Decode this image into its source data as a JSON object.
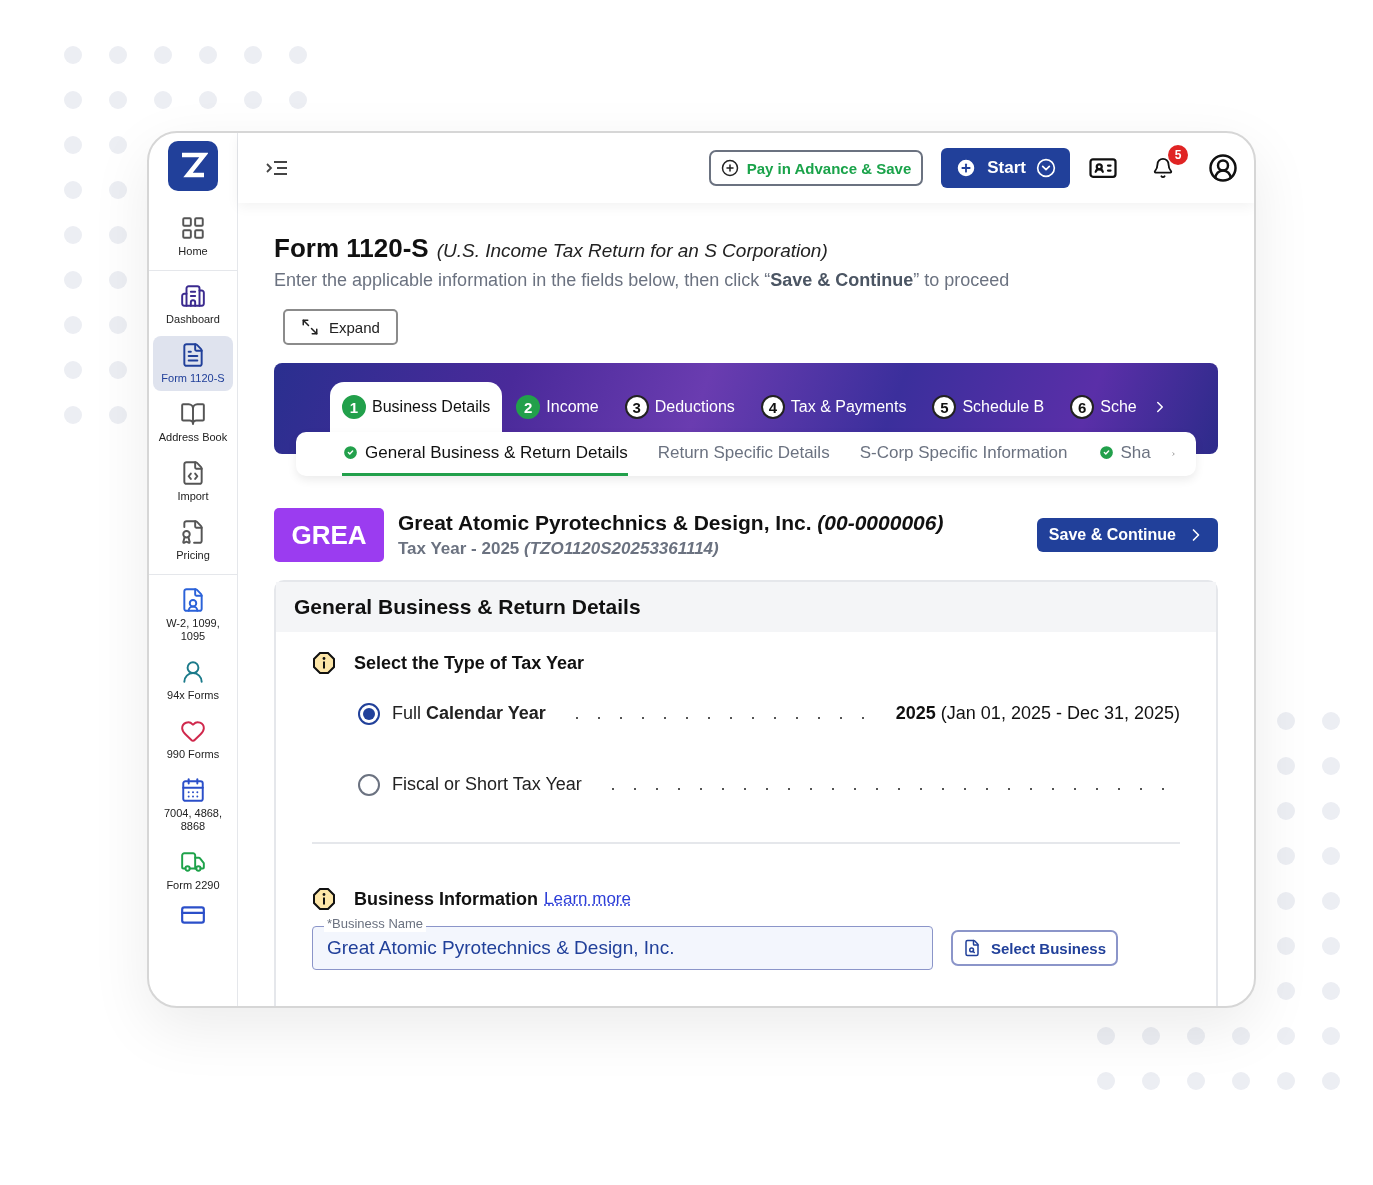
{
  "sidebar": {
    "groups": [
      {
        "items": [
          {
            "label": "Home",
            "selected": false
          }
        ]
      },
      {
        "items": [
          {
            "label": "Dashboard",
            "selected": false
          },
          {
            "label": "Form 1120-S",
            "selected": true
          },
          {
            "label": "Address Book",
            "selected": false
          },
          {
            "label": "Import",
            "selected": false
          },
          {
            "label": "Pricing",
            "selected": false
          }
        ]
      },
      {
        "items": [
          {
            "label": "W-2, 1099, 1095",
            "selected": false
          },
          {
            "label": "94x Forms",
            "selected": false
          },
          {
            "label": "990 Forms",
            "selected": false
          },
          {
            "label": "7004, 4868, 8868",
            "selected": false
          },
          {
            "label": "Form 2290",
            "selected": false
          }
        ]
      }
    ]
  },
  "topbar": {
    "pay_button": "Pay in Advance & Save",
    "start_button": "Start",
    "notifications": "5"
  },
  "header": {
    "title": "Form 1120-S",
    "subtitle": "(U.S. Income Tax Return for an S Corporation)",
    "instruction": "Enter the applicable information in the fields below, then click “**Save & Continue**” to proceed",
    "expand_button": "Expand"
  },
  "steps": [
    {
      "number": "1",
      "label": "Business Details",
      "selected": true,
      "done": true
    },
    {
      "number": "2",
      "label": "Income",
      "selected": false,
      "done": true
    },
    {
      "number": "3",
      "label": "Deductions",
      "selected": false,
      "done": false
    },
    {
      "number": "4",
      "label": "Tax & Payments",
      "selected": false,
      "done": false
    },
    {
      "number": "5",
      "label": "Schedule B",
      "selected": false,
      "done": false
    },
    {
      "number": "6",
      "label": "Sche",
      "selected": false,
      "done": false
    }
  ],
  "subtabs": [
    {
      "label": "General Business & Return Details",
      "selected": true,
      "done": true
    },
    {
      "label": "Return Specific Details",
      "selected": false,
      "done": false
    },
    {
      "label": "S-Corp Specific Information",
      "selected": false,
      "done": false
    },
    {
      "label": "Sha",
      "selected": false,
      "done": true
    }
  ],
  "business": {
    "badge": "GREA",
    "name": "Great Atomic Pyrotechnics & Design, Inc. *(00-0000006)*",
    "tax_year": "Tax Year - 2025 *(TZO1120S20253361114)*",
    "save_button": "Save & Continue"
  },
  "card": {
    "title": "General Business & Return Details",
    "tax_year_section": {
      "title": "Select the Type of Tax Year",
      "options": [
        {
          "label": "Full **Calendar Year**",
          "value": "**2025** (Jan 01, 2025 - Dec 31, 2025)",
          "selected": true
        },
        {
          "label": "Fiscal or Short Tax Year",
          "selected": false
        }
      ]
    },
    "business_section": {
      "title": "Business Information",
      "link": "Learn more",
      "field_label": "*Business Name",
      "field_value": "Great Atomic Pyrotechnics & Design, Inc.",
      "select_button": "Select Business"
    }
  }
}
